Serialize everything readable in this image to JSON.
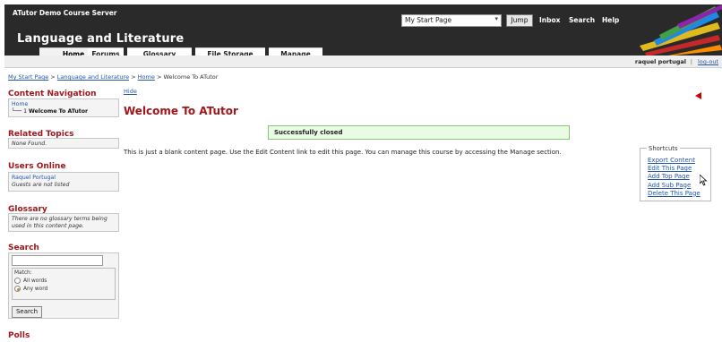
{
  "header": {
    "site_name": "ATutor Demo Course Server",
    "course_title": "Language and Literature",
    "jump_select_value": "My Start Page",
    "jump_label": "Jump",
    "links": [
      "Inbox",
      "Search",
      "Help"
    ]
  },
  "tabs": [
    {
      "label": "Home",
      "active": true
    },
    {
      "label": "Forums",
      "active": false
    },
    {
      "label": "Glossary",
      "active": false
    },
    {
      "label": "File Storage",
      "active": false
    },
    {
      "label": "Manage",
      "active": false
    }
  ],
  "userbar": {
    "user": "raquel portugal",
    "separator": "|",
    "logout": "log-out"
  },
  "breadcrumb": {
    "items": [
      "My Start Page",
      "Language and Literature",
      "Home"
    ],
    "separator": " > ",
    "current": "Welcome To ATutor"
  },
  "sidebar": {
    "content_nav": {
      "heading": "Content Navigation",
      "home_link": "Home",
      "tree_prefix": "└── 1 ",
      "tree_item": "Welcome To ATutor"
    },
    "related": {
      "heading": "Related Topics",
      "text": "None Found."
    },
    "users": {
      "heading": "Users Online",
      "user": "Raquel Portugal",
      "guests": "Guests are not listed"
    },
    "glossary": {
      "heading": "Glossary",
      "text": "There are no glossary terms being used in this content page."
    },
    "search": {
      "heading": "Search",
      "input_value": "",
      "match_label": "Match:",
      "options": [
        {
          "label": "All words",
          "selected": false
        },
        {
          "label": "Any word",
          "selected": true
        }
      ],
      "button": "Search"
    },
    "polls": {
      "heading": "Polls"
    }
  },
  "main": {
    "hide_link": "Hide",
    "title": "Welcome To ATutor",
    "feedback": "Successfully closed",
    "content": "This is just a blank content page. Use the Edit Content link to edit this page. You can manage this course by accessing the Manage section."
  },
  "shortcuts": {
    "legend": "Shortcuts",
    "items": [
      "Export Content",
      "Edit This Page",
      "Add Top Page",
      "Add Sub Page",
      "Delete This Page"
    ]
  },
  "colors": {
    "header_bg": "#2a2a2a",
    "heading_red": "#a0161b",
    "link_blue": "#2255aa",
    "feedback_bg": "#e9fbe5",
    "feedback_border": "#8cc37a"
  }
}
